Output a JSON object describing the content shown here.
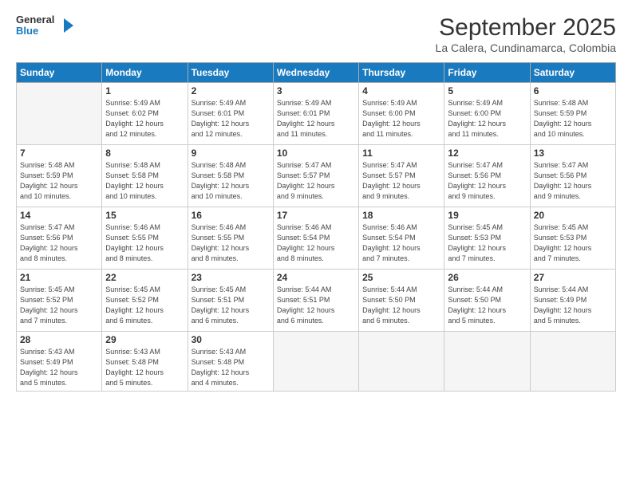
{
  "logo": {
    "line1": "General",
    "line2": "Blue"
  },
  "title": "September 2025",
  "location": "La Calera, Cundinamarca, Colombia",
  "days_header": [
    "Sunday",
    "Monday",
    "Tuesday",
    "Wednesday",
    "Thursday",
    "Friday",
    "Saturday"
  ],
  "weeks": [
    [
      {
        "num": "",
        "info": ""
      },
      {
        "num": "1",
        "info": "Sunrise: 5:49 AM\nSunset: 6:02 PM\nDaylight: 12 hours\nand 12 minutes."
      },
      {
        "num": "2",
        "info": "Sunrise: 5:49 AM\nSunset: 6:01 PM\nDaylight: 12 hours\nand 12 minutes."
      },
      {
        "num": "3",
        "info": "Sunrise: 5:49 AM\nSunset: 6:01 PM\nDaylight: 12 hours\nand 11 minutes."
      },
      {
        "num": "4",
        "info": "Sunrise: 5:49 AM\nSunset: 6:00 PM\nDaylight: 12 hours\nand 11 minutes."
      },
      {
        "num": "5",
        "info": "Sunrise: 5:49 AM\nSunset: 6:00 PM\nDaylight: 12 hours\nand 11 minutes."
      },
      {
        "num": "6",
        "info": "Sunrise: 5:48 AM\nSunset: 5:59 PM\nDaylight: 12 hours\nand 10 minutes."
      }
    ],
    [
      {
        "num": "7",
        "info": "Sunrise: 5:48 AM\nSunset: 5:59 PM\nDaylight: 12 hours\nand 10 minutes."
      },
      {
        "num": "8",
        "info": "Sunrise: 5:48 AM\nSunset: 5:58 PM\nDaylight: 12 hours\nand 10 minutes."
      },
      {
        "num": "9",
        "info": "Sunrise: 5:48 AM\nSunset: 5:58 PM\nDaylight: 12 hours\nand 10 minutes."
      },
      {
        "num": "10",
        "info": "Sunrise: 5:47 AM\nSunset: 5:57 PM\nDaylight: 12 hours\nand 9 minutes."
      },
      {
        "num": "11",
        "info": "Sunrise: 5:47 AM\nSunset: 5:57 PM\nDaylight: 12 hours\nand 9 minutes."
      },
      {
        "num": "12",
        "info": "Sunrise: 5:47 AM\nSunset: 5:56 PM\nDaylight: 12 hours\nand 9 minutes."
      },
      {
        "num": "13",
        "info": "Sunrise: 5:47 AM\nSunset: 5:56 PM\nDaylight: 12 hours\nand 9 minutes."
      }
    ],
    [
      {
        "num": "14",
        "info": "Sunrise: 5:47 AM\nSunset: 5:56 PM\nDaylight: 12 hours\nand 8 minutes."
      },
      {
        "num": "15",
        "info": "Sunrise: 5:46 AM\nSunset: 5:55 PM\nDaylight: 12 hours\nand 8 minutes."
      },
      {
        "num": "16",
        "info": "Sunrise: 5:46 AM\nSunset: 5:55 PM\nDaylight: 12 hours\nand 8 minutes."
      },
      {
        "num": "17",
        "info": "Sunrise: 5:46 AM\nSunset: 5:54 PM\nDaylight: 12 hours\nand 8 minutes."
      },
      {
        "num": "18",
        "info": "Sunrise: 5:46 AM\nSunset: 5:54 PM\nDaylight: 12 hours\nand 7 minutes."
      },
      {
        "num": "19",
        "info": "Sunrise: 5:45 AM\nSunset: 5:53 PM\nDaylight: 12 hours\nand 7 minutes."
      },
      {
        "num": "20",
        "info": "Sunrise: 5:45 AM\nSunset: 5:53 PM\nDaylight: 12 hours\nand 7 minutes."
      }
    ],
    [
      {
        "num": "21",
        "info": "Sunrise: 5:45 AM\nSunset: 5:52 PM\nDaylight: 12 hours\nand 7 minutes."
      },
      {
        "num": "22",
        "info": "Sunrise: 5:45 AM\nSunset: 5:52 PM\nDaylight: 12 hours\nand 6 minutes."
      },
      {
        "num": "23",
        "info": "Sunrise: 5:45 AM\nSunset: 5:51 PM\nDaylight: 12 hours\nand 6 minutes."
      },
      {
        "num": "24",
        "info": "Sunrise: 5:44 AM\nSunset: 5:51 PM\nDaylight: 12 hours\nand 6 minutes."
      },
      {
        "num": "25",
        "info": "Sunrise: 5:44 AM\nSunset: 5:50 PM\nDaylight: 12 hours\nand 6 minutes."
      },
      {
        "num": "26",
        "info": "Sunrise: 5:44 AM\nSunset: 5:50 PM\nDaylight: 12 hours\nand 5 minutes."
      },
      {
        "num": "27",
        "info": "Sunrise: 5:44 AM\nSunset: 5:49 PM\nDaylight: 12 hours\nand 5 minutes."
      }
    ],
    [
      {
        "num": "28",
        "info": "Sunrise: 5:43 AM\nSunset: 5:49 PM\nDaylight: 12 hours\nand 5 minutes."
      },
      {
        "num": "29",
        "info": "Sunrise: 5:43 AM\nSunset: 5:48 PM\nDaylight: 12 hours\nand 5 minutes."
      },
      {
        "num": "30",
        "info": "Sunrise: 5:43 AM\nSunset: 5:48 PM\nDaylight: 12 hours\nand 4 minutes."
      },
      {
        "num": "",
        "info": ""
      },
      {
        "num": "",
        "info": ""
      },
      {
        "num": "",
        "info": ""
      },
      {
        "num": "",
        "info": ""
      }
    ]
  ]
}
